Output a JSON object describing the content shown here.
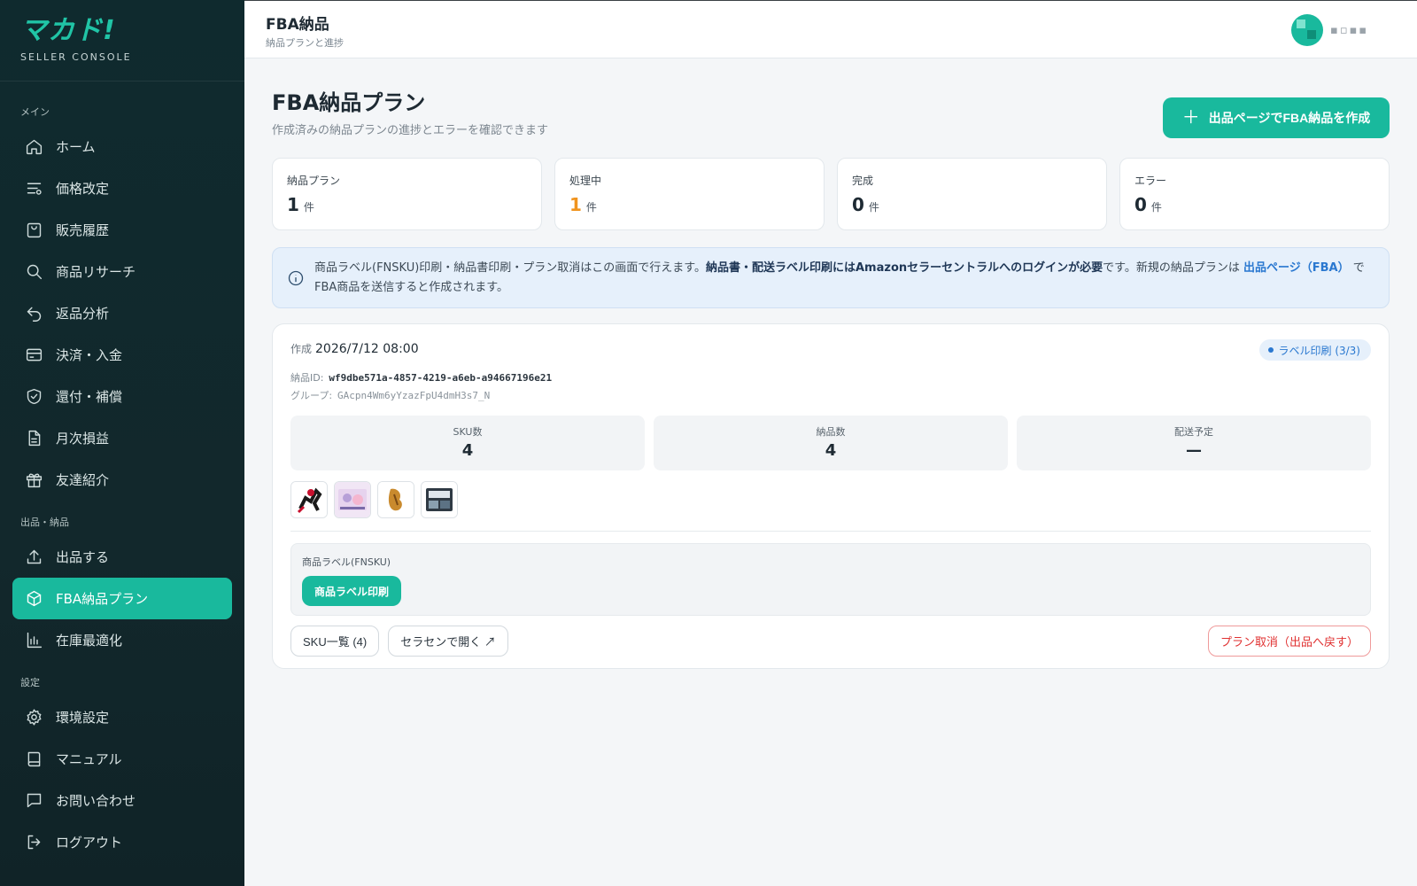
{
  "brand": {
    "logo": "マカド!",
    "subtitle": "SELLER CONSOLE"
  },
  "sidebar": {
    "sections": [
      {
        "label": "メイン",
        "items": [
          {
            "label": "ホーム",
            "icon": "home-icon"
          },
          {
            "label": "価格改定",
            "icon": "sliders-icon"
          },
          {
            "label": "販売履歴",
            "icon": "shopping-bag-icon"
          },
          {
            "label": "商品リサーチ",
            "icon": "search-icon"
          },
          {
            "label": "返品分析",
            "icon": "return-icon"
          },
          {
            "label": "決済・入金",
            "icon": "credit-card-icon"
          },
          {
            "label": "還付・補償",
            "icon": "shield-check-icon"
          },
          {
            "label": "月次損益",
            "icon": "document-icon"
          },
          {
            "label": "友達紹介",
            "icon": "gift-icon"
          }
        ]
      },
      {
        "label": "出品・納品",
        "items": [
          {
            "label": "出品する",
            "icon": "upload-icon"
          },
          {
            "label": "FBA納品プラン",
            "icon": "box-icon",
            "active": true
          },
          {
            "label": "在庫最適化",
            "icon": "bar-chart-icon"
          }
        ]
      },
      {
        "label": "設定",
        "items": [
          {
            "label": "環境設定",
            "icon": "gear-icon"
          },
          {
            "label": "マニュアル",
            "icon": "book-icon"
          },
          {
            "label": "お問い合わせ",
            "icon": "chat-icon"
          },
          {
            "label": "ログアウト",
            "icon": "logout-icon"
          }
        ]
      }
    ]
  },
  "header": {
    "title": "FBA納品",
    "subtitle": "納品プランと進捗"
  },
  "page": {
    "title": "FBA納品プラン",
    "description": "作成済みの納品プランの進捗とエラーを確認できます",
    "create_button": "出品ページでFBA納品を作成"
  },
  "stats": [
    {
      "label": "納品プラン",
      "value": "1",
      "unit": "件"
    },
    {
      "label": "処理中",
      "value": "1",
      "unit": "件"
    },
    {
      "label": "完成",
      "value": "0",
      "unit": "件"
    },
    {
      "label": "エラー",
      "value": "0",
      "unit": "件"
    }
  ],
  "info": {
    "text1": "商品ラベル(FNSKU)印刷・納品書印刷・プラン取消はこの画面で行えます。",
    "bold": "納品書・配送ラベル印刷にはAmazonセラーセントラルへのログインが必要",
    "text2": "です。新規の納品プランは",
    "link": "出品ページ（FBA）",
    "text3": "でFBA商品を送信すると作成されます。"
  },
  "plan": {
    "created_label": "作成",
    "created_at": "2026/7/12 08:00",
    "status": "ラベル印刷 (3/3)",
    "id_label": "納品ID:",
    "id": "wf9dbe571a-4857-4219-a6eb-a94667196e21",
    "group_label": "グループ:",
    "group": "GAcpn4Wm6yYzazFpU4dmH3s7_N",
    "metrics": [
      {
        "label": "SKU数",
        "value": "4"
      },
      {
        "label": "納品数",
        "value": "4"
      },
      {
        "label": "配送予定",
        "value": "—"
      }
    ],
    "label_section_title": "商品ラベル(FNSKU)",
    "label_print_button": "商品ラベル印刷",
    "sku_list_button": "SKU一覧 (4)",
    "seller_central_button": "セラセンで開く ↗",
    "cancel_button": "プラン取消（出品へ戻す）"
  },
  "colors": {
    "accent": "#19b99d",
    "sidebar_bg": "#0f2a2e",
    "processing": "#f0941f",
    "info_bg": "#e6f0fb",
    "danger": "#e03131"
  }
}
